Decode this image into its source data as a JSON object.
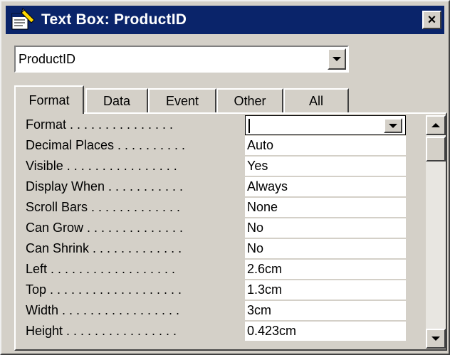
{
  "window": {
    "title": "Text Box: ProductID",
    "close_glyph": "×"
  },
  "object_selector": {
    "value": "ProductID"
  },
  "tabs": [
    {
      "label": "Format",
      "active": true
    },
    {
      "label": "Data",
      "active": false
    },
    {
      "label": "Event",
      "active": false
    },
    {
      "label": "Other",
      "active": false
    },
    {
      "label": "All",
      "active": false
    }
  ],
  "properties": [
    {
      "label": "Format . . . . . . . . . . . . . . .",
      "value": ""
    },
    {
      "label": "Decimal Places . . . . . . . . . .",
      "value": "Auto"
    },
    {
      "label": "Visible . . . . . . . . . . . . . . . .",
      "value": "Yes"
    },
    {
      "label": "Display When . . . . . . . . . . .",
      "value": "Always"
    },
    {
      "label": "Scroll Bars . . . . . . . . . . . . .",
      "value": "None"
    },
    {
      "label": "Can Grow . . . . . . . . . . . . . .",
      "value": "No"
    },
    {
      "label": "Can Shrink . . . . . . . . . . . . .",
      "value": "No"
    },
    {
      "label": "Left . . . . . . . . . . . . . . . . . .",
      "value": "2.6cm"
    },
    {
      "label": "Top . . . . . . . . . . . . . . . . . . .",
      "value": "1.3cm"
    },
    {
      "label": "Width . . . . . . . . . . . . . . . . .",
      "value": "3cm"
    },
    {
      "label": "Height . . . . . . . . . . . . . . . .",
      "value": "0.423cm"
    }
  ],
  "colors": {
    "titlebar": "#0a246a",
    "face": "#d4d0c8"
  }
}
